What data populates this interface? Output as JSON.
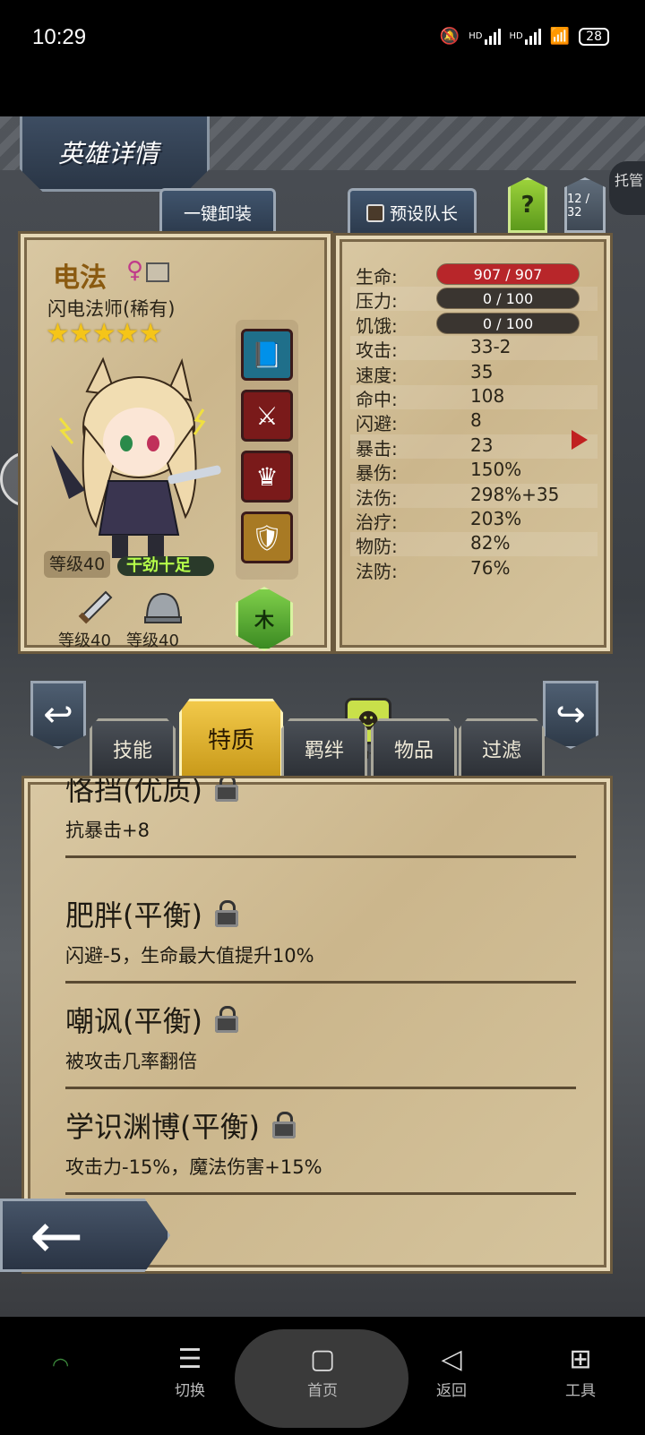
{
  "status": {
    "time": "10:29",
    "battery": "28",
    "net1": "HD",
    "net2": "HD"
  },
  "header": {
    "title": "英雄详情",
    "unequip_all": "一键卸装",
    "preset_captain": "预设队长",
    "help": "?",
    "page_count": "12 / 32",
    "hosted": "托管"
  },
  "hero": {
    "name": "电法",
    "gender": "♀",
    "class": "闪电法师(稀有)",
    "stars": "★★★★★",
    "level": "等级40",
    "trait_tag": "干劲十足",
    "weapon_level": "等级40",
    "armor_level": "等级40",
    "element": "木"
  },
  "stats": [
    {
      "label": "生命:",
      "value": "907 / 907",
      "kind": "bar-hp"
    },
    {
      "label": "压力:",
      "value": "0 / 100",
      "kind": "bar"
    },
    {
      "label": "饥饿:",
      "value": "0 / 100",
      "kind": "bar"
    },
    {
      "label": "攻击:",
      "value": "33-2"
    },
    {
      "label": "速度:",
      "value": "35"
    },
    {
      "label": "命中:",
      "value": "108"
    },
    {
      "label": "闪避:",
      "value": "8"
    },
    {
      "label": "暴击:",
      "value": "23"
    },
    {
      "label": "暴伤:",
      "value": "150%"
    },
    {
      "label": "法伤:",
      "value": "298%+35"
    },
    {
      "label": "治疗:",
      "value": "203%"
    },
    {
      "label": "物防:",
      "value": "82%"
    },
    {
      "label": "法防:",
      "value": "76%"
    }
  ],
  "trait_tile_label": "干劲十足",
  "tabs": [
    "技能",
    "特质",
    "羁绊",
    "物品",
    "过滤"
  ],
  "active_tab": "特质",
  "traits": [
    {
      "name": "恪挡(优质)",
      "desc": "抗暴击+8"
    },
    {
      "name": "肥胖(平衡)",
      "desc": "闪避-5，生命最大值提升10%"
    },
    {
      "name": "嘲讽(平衡)",
      "desc": "被攻击几率翻倍"
    },
    {
      "name": "学识渊博(平衡)",
      "desc": "攻击力-15%，魔法伤害+15%"
    }
  ],
  "sysnav": {
    "switch": "切换",
    "home": "首页",
    "back": "返回",
    "tools": "工具"
  },
  "colors": {
    "hp_bar": "#b8262a",
    "active_tab": "#f2c94a",
    "element": "#5ca832"
  }
}
